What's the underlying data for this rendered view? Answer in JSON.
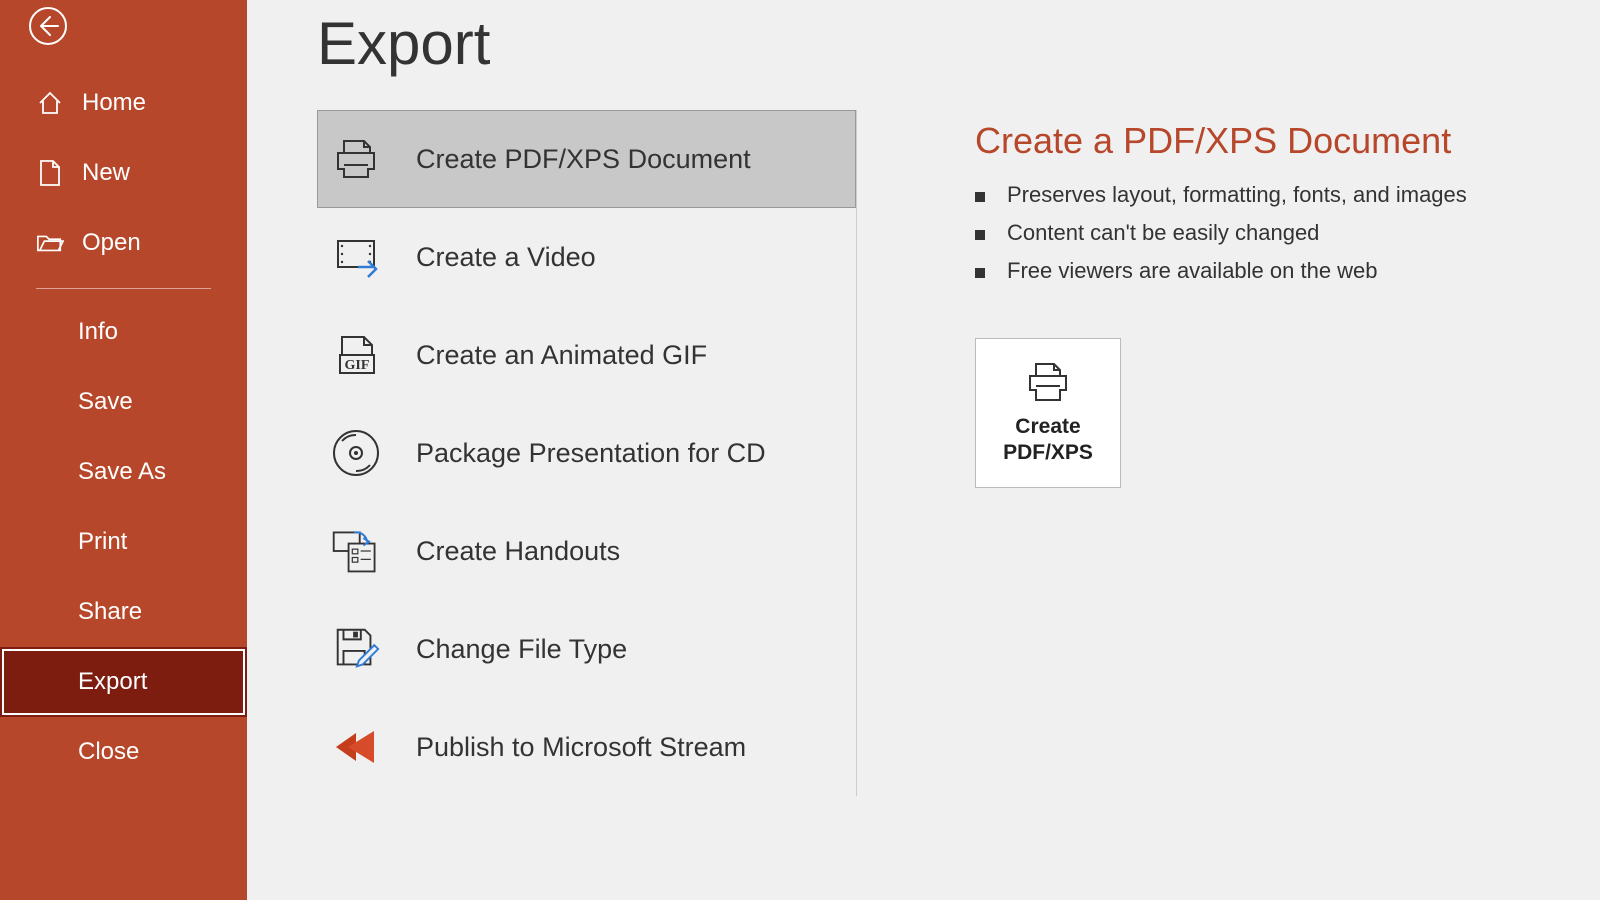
{
  "sidebar": {
    "items": [
      {
        "key": "home",
        "label": "Home",
        "icon": "home-icon",
        "indent": false
      },
      {
        "key": "new",
        "label": "New",
        "icon": "file-icon",
        "indent": false
      },
      {
        "key": "open",
        "label": "Open",
        "icon": "folder-icon",
        "indent": false
      },
      {
        "key": "info",
        "label": "Info",
        "icon": null,
        "indent": true
      },
      {
        "key": "save",
        "label": "Save",
        "icon": null,
        "indent": true
      },
      {
        "key": "saveas",
        "label": "Save As",
        "icon": null,
        "indent": true
      },
      {
        "key": "print",
        "label": "Print",
        "icon": null,
        "indent": true
      },
      {
        "key": "share",
        "label": "Share",
        "icon": null,
        "indent": true
      },
      {
        "key": "export",
        "label": "Export",
        "icon": null,
        "indent": true,
        "selected": true
      },
      {
        "key": "close",
        "label": "Close",
        "icon": null,
        "indent": true
      }
    ]
  },
  "main": {
    "title": "Export",
    "options": [
      {
        "key": "pdf",
        "label": "Create PDF/XPS Document",
        "icon": "printer-icon",
        "selected": true
      },
      {
        "key": "video",
        "label": "Create a Video",
        "icon": "film-icon"
      },
      {
        "key": "gif",
        "label": "Create an Animated GIF",
        "icon": "gif-icon"
      },
      {
        "key": "cd",
        "label": "Package Presentation for CD",
        "icon": "disc-icon"
      },
      {
        "key": "handout",
        "label": "Create Handouts",
        "icon": "handout-icon"
      },
      {
        "key": "filetype",
        "label": "Change File Type",
        "icon": "save-pencil-icon"
      },
      {
        "key": "stream",
        "label": "Publish to Microsoft Stream",
        "icon": "stream-icon"
      }
    ],
    "detail": {
      "title": "Create a PDF/XPS Document",
      "bullets": [
        "Preserves layout, formatting, fonts, and images",
        "Content can't be easily changed",
        "Free viewers are available on the web"
      ],
      "button": {
        "line1": "Create",
        "line2": "PDF/XPS"
      }
    }
  }
}
